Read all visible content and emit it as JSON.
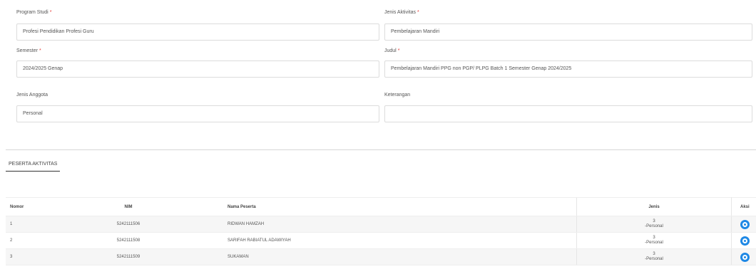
{
  "form": {
    "program_studi": {
      "label": "Program Studi",
      "value": "Profesi Pendidikan Profesi Guru"
    },
    "jenis_aktivitas": {
      "label": "Jenis Aktivitas",
      "value": "Pembelajaran Mandiri"
    },
    "semester": {
      "label": "Semester",
      "value": "2024/2025 Genap"
    },
    "judul": {
      "label": "Judul",
      "value": "Pembelajaran Mandiri PPG non PGP/ PLPG Batch 1 Semester Genap 2024/2025"
    },
    "jenis_anggota": {
      "label": "Jenis Anggota",
      "value": "Personal"
    },
    "keterangan": {
      "label": "Keterangan",
      "value": ""
    },
    "required_mark": "*"
  },
  "tab": {
    "label": "PESERTA AKTIVITAS"
  },
  "table": {
    "headers": {
      "nomor": "Nomor",
      "nim": "NIM",
      "nama": "Nama Peserta",
      "jenis": "Jenis",
      "aksi": "Aksi"
    },
    "rows": [
      {
        "nomor": "1",
        "nim": "5242111506",
        "nama": "RIDWAN HAMZAH",
        "jenis_num": "3",
        "jenis_txt": "-Personal",
        "action_icon": "view-icon"
      },
      {
        "nomor": "2",
        "nim": "5242111508",
        "nama": "SARIFAH RABIATUL ADAWIYAH",
        "jenis_num": "3",
        "jenis_txt": "-Personal",
        "action_icon": "view-icon"
      },
      {
        "nomor": "3",
        "nim": "5242111509",
        "nama": "SUKAMAN",
        "jenis_num": "3",
        "jenis_txt": "-Personal",
        "action_icon": "view-icon"
      }
    ]
  },
  "colors": {
    "required": "#e53935",
    "action": "#1e88e5"
  }
}
